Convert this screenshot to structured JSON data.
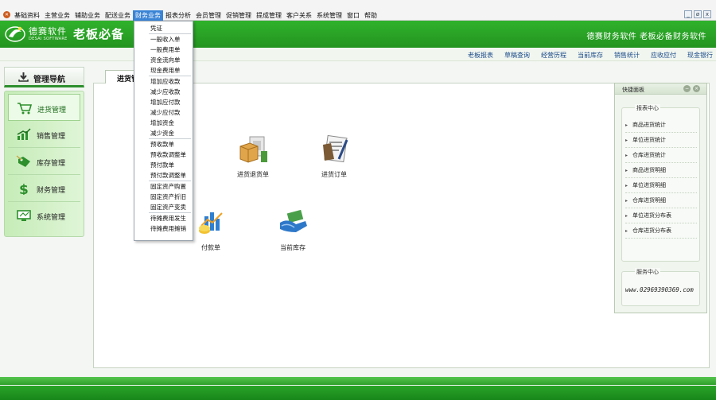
{
  "menubar": {
    "app_icon": "app-logo-icon",
    "items": [
      "基础资料",
      "主营业务",
      "辅助业务",
      "配送业务",
      "财务业务",
      "报表分析",
      "会员管理",
      "促销管理",
      "提成管理",
      "客户关系",
      "系统管理",
      "窗口",
      "帮助"
    ],
    "active_index": 4,
    "window_buttons": [
      "_",
      "ø",
      "x"
    ]
  },
  "header": {
    "brand_cn": "德赛软件",
    "brand_en": "DESAI SOFTWARE",
    "slogan": "老板必备",
    "right_text": "德赛财务软件  老板必备财务软件",
    "background_color": "#2aa428"
  },
  "quicklinks": [
    "老板报表",
    "草稿查询",
    "经营历程",
    "当前库存",
    "销售统计",
    "应收应付",
    "现金银行"
  ],
  "sidebar": {
    "title": "管理导航",
    "items": [
      {
        "label": "进货管理",
        "icon": "shopping-cart-icon"
      },
      {
        "label": "销售管理",
        "icon": "trend-chart-icon"
      },
      {
        "label": "库存管理",
        "icon": "inventory-tag-icon"
      },
      {
        "label": "财务管理",
        "icon": "dollar-icon"
      },
      {
        "label": "系统管理",
        "icon": "monitor-icon"
      }
    ],
    "active_index": 0
  },
  "main": {
    "tab_label": "进货管",
    "modules": [
      {
        "label": "进货退货单",
        "icon": "package-icon"
      },
      {
        "label": "进货订单",
        "icon": "order-form-icon"
      },
      {
        "label": "付款单",
        "icon": "payment-chart-icon"
      },
      {
        "label": "当前库存",
        "icon": "stock-handover-icon"
      }
    ]
  },
  "quick_panel": {
    "title": "快捷面板",
    "report_center": {
      "title": "报表中心",
      "links": [
        "商品进货统计",
        "单位进货统计",
        "仓库进货统计",
        "商品进货明细",
        "单位进货明细",
        "仓库进货明细",
        "单位进货分布表",
        "仓库进货分布表"
      ]
    },
    "service_center": {
      "title": "服务中心",
      "phone": "www.02969390369.com"
    }
  },
  "dropdown": {
    "groups": [
      [
        "凭证"
      ],
      [
        "一般收入单",
        "一般费用单",
        "资金流向单",
        "现金费用单"
      ],
      [
        "增加应收款",
        "减少应收款",
        "增加应付款",
        "减少应付款",
        "增加资金",
        "减少资金"
      ],
      [
        "预收款单",
        "预收款调整单",
        "预付款单",
        "预付款调整单"
      ],
      [
        "固定资产购置",
        "固定资产折旧",
        "固定资产变卖"
      ],
      [
        "待摊费用发生",
        "待摊费用摊销"
      ]
    ]
  }
}
